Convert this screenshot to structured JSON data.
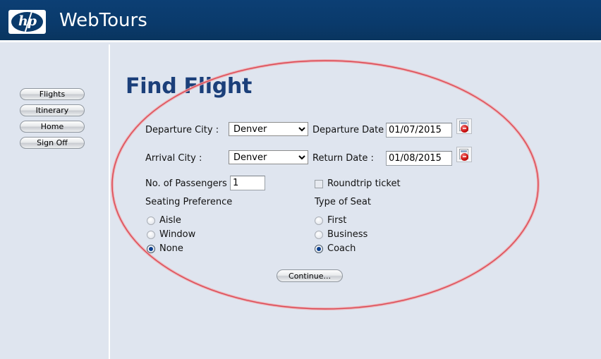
{
  "header": {
    "logo_text": "hp",
    "logo_icon": "hp-logo-icon",
    "brand": "WebTours"
  },
  "sidebar": {
    "items": [
      {
        "label": "Flights"
      },
      {
        "label": "Itinerary"
      },
      {
        "label": "Home"
      },
      {
        "label": "Sign Off"
      }
    ]
  },
  "main": {
    "title": "Find Flight",
    "fields": {
      "departure_city_label": "Departure City :",
      "departure_city_value": "Denver",
      "arrival_city_label": "Arrival City :",
      "arrival_city_value": "Denver",
      "departure_date_label": "Departure Date :",
      "departure_date_value": "01/07/2015",
      "return_date_label": "Return Date :",
      "return_date_value": "01/08/2015",
      "passengers_label": "No. of Passengers :",
      "passengers_value": "1",
      "roundtrip_label": "Roundtrip ticket",
      "roundtrip_checked": false,
      "calendar_icon": "calendar-picker-icon"
    },
    "seating_preference": {
      "legend": "Seating Preference",
      "options": [
        {
          "label": "Aisle",
          "selected": false
        },
        {
          "label": "Window",
          "selected": false
        },
        {
          "label": "None",
          "selected": true
        }
      ]
    },
    "type_of_seat": {
      "legend": "Type of Seat",
      "options": [
        {
          "label": "First",
          "selected": false
        },
        {
          "label": "Business",
          "selected": false
        },
        {
          "label": "Coach",
          "selected": true
        }
      ]
    },
    "continue_label": "Continue..."
  },
  "annotation": {
    "shape": "ellipse-highlight",
    "color": "#e8646b"
  },
  "colors": {
    "header_bg": "#0a3a6b",
    "page_bg": "#dfe5ef",
    "title_blue": "#1b3f7a",
    "annotation_red": "#e8646b"
  }
}
